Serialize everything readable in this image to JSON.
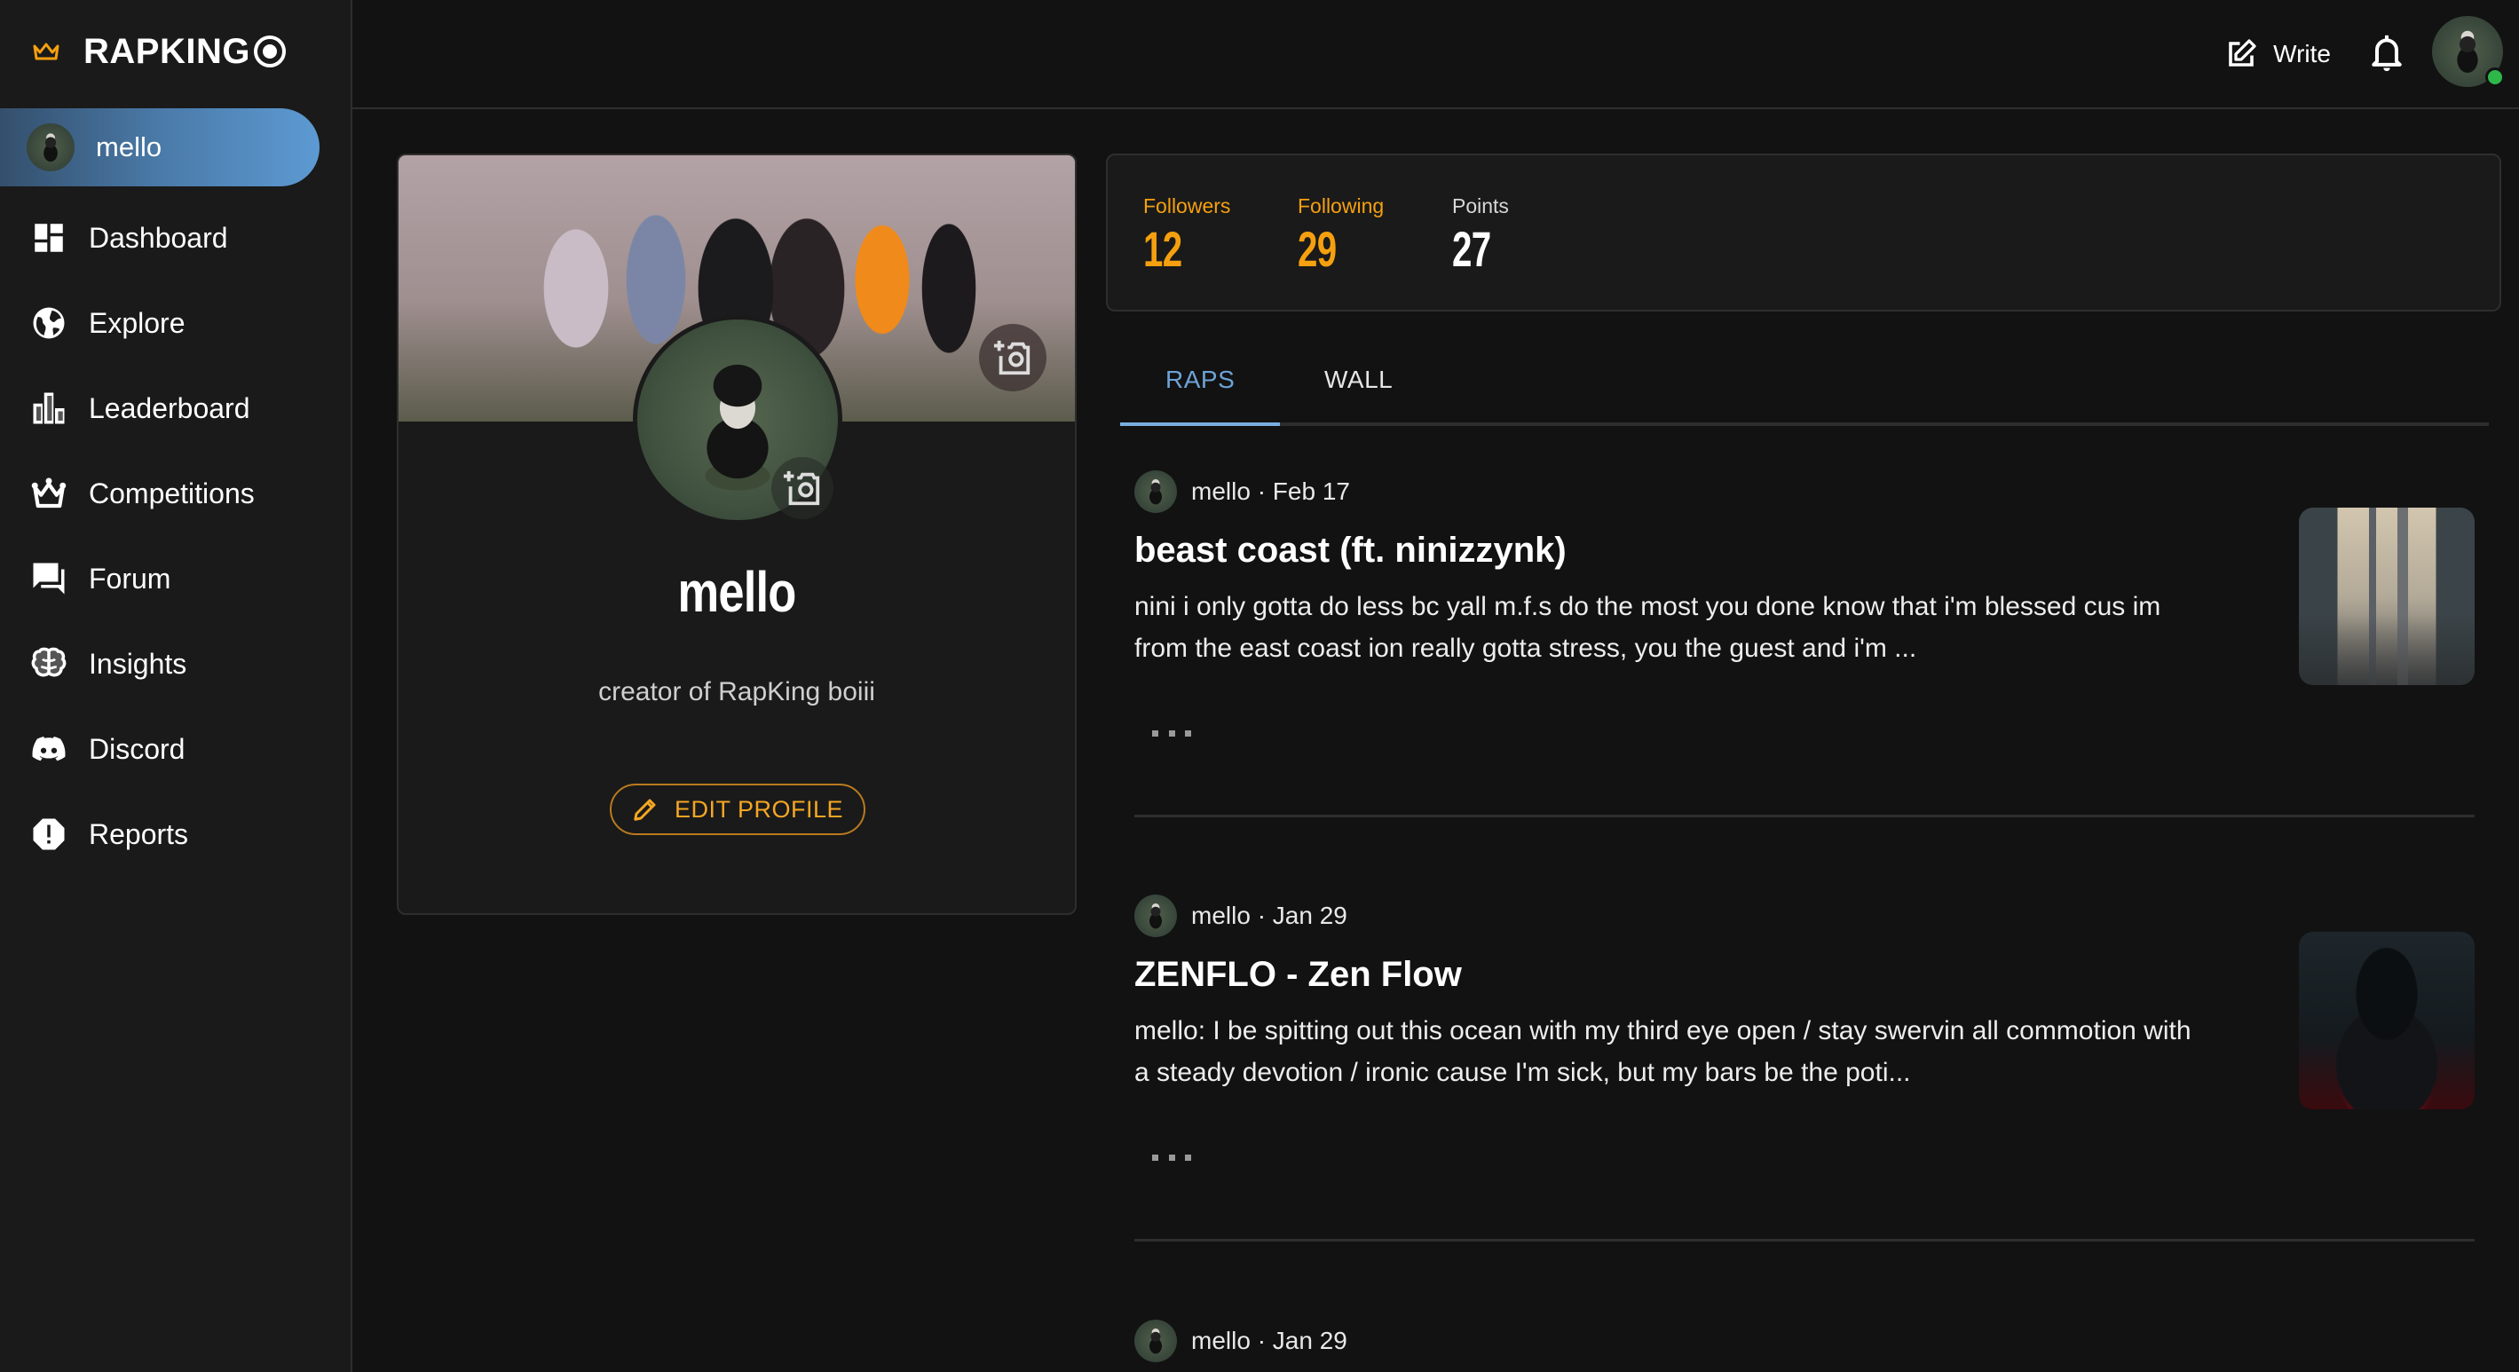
{
  "brand": {
    "name": "RAPKING",
    "crown_icon": "crown-icon",
    "toggle_icon": "radio-button-icon",
    "accent_color": "#f5a00f"
  },
  "sidebar": {
    "user": {
      "label": "mello",
      "icon": "avatar"
    },
    "items": [
      {
        "label": "Dashboard",
        "icon": "dashboard-icon"
      },
      {
        "label": "Explore",
        "icon": "globe-icon"
      },
      {
        "label": "Leaderboard",
        "icon": "leaderboard-icon"
      },
      {
        "label": "Competitions",
        "icon": "crown-icon"
      },
      {
        "label": "Forum",
        "icon": "forum-icon"
      },
      {
        "label": "Insights",
        "icon": "brain-icon"
      },
      {
        "label": "Discord",
        "icon": "discord-icon"
      },
      {
        "label": "Reports",
        "icon": "report-icon"
      }
    ]
  },
  "header": {
    "write_label": "Write",
    "write_icon": "edit-square-icon",
    "notifications_icon": "bell-icon",
    "online_status_color": "#2fb84a"
  },
  "profile": {
    "username": "mello",
    "bio": "creator of RapKing boiii",
    "edit_label": "EDIT PROFILE",
    "edit_icon": "pencil-icon",
    "cover_camera_icon": "add-photo-icon",
    "avatar_camera_icon": "add-photo-icon"
  },
  "stats": {
    "followers": {
      "label": "Followers",
      "value": "12"
    },
    "following": {
      "label": "Following",
      "value": "29"
    },
    "points": {
      "label": "Points",
      "value": "27"
    }
  },
  "tabs": {
    "items": [
      {
        "label": "RAPS",
        "active": true
      },
      {
        "label": "WALL",
        "active": false
      }
    ],
    "active_color": "#6ea3d6"
  },
  "posts": [
    {
      "author": "mello",
      "date": "Feb 17",
      "meta": "mello · Feb 17",
      "title": "beast coast (ft. ninizzynk)",
      "excerpt": "nini i only gotta do less bc yall m.f.s do the most you done know that i'm blessed cus im from the east coast ion really gotta stress, you the guest and i'm ...",
      "thumbnail": "city-street-artwork"
    },
    {
      "author": "mello",
      "date": "Jan 29",
      "meta": "mello · Jan 29",
      "title": "ZENFLO - Zen Flow",
      "excerpt": "mello: I be spitting out this ocean with my third eye open / stay swervin all commotion with a steady devotion / ironic cause I'm sick, but my bars be the poti...",
      "thumbnail": "hooded-figure-artwork"
    },
    {
      "author": "mello",
      "date": "Jan 29",
      "meta": "mello · Jan 29"
    }
  ]
}
